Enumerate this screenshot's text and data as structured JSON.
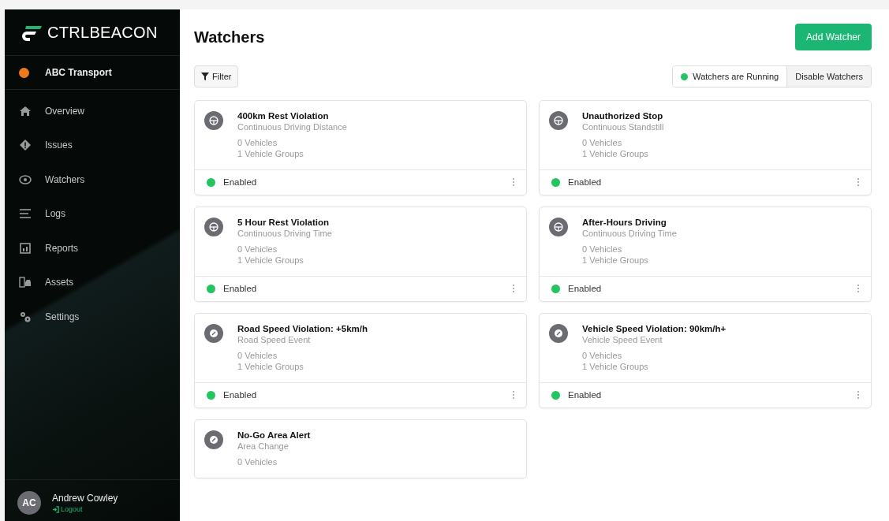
{
  "brand": {
    "logo": "**CTRL**BEACON"
  },
  "organization": {
    "name": "ABC Transport",
    "color": "#f07a1a"
  },
  "nav": [
    {
      "label": "Overview",
      "kind": "home",
      "selected": false
    },
    {
      "label": "Issues",
      "kind": "diamond",
      "selected": false
    },
    {
      "label": "Watchers",
      "kind": "eye",
      "selected": false
    },
    {
      "label": "Logs",
      "kind": "lines",
      "selected": false
    },
    {
      "label": "Reports",
      "kind": "report",
      "selected": false
    },
    {
      "label": "Assets",
      "kind": "assets",
      "selected": false
    },
    {
      "label": "Settings",
      "kind": "gears",
      "selected": false
    }
  ],
  "user": {
    "initials": "AC",
    "name": "Andrew Cowley",
    "logout": "Logout"
  },
  "page": {
    "title": "Watchers",
    "add_button": "Add Watcher",
    "filter_button": "Filter",
    "status": {
      "label": "Watchers are Running",
      "running": true
    },
    "toggle_button": "Disable Watchers"
  },
  "watchers": [
    {
      "title": "400km Rest Violation",
      "type": "Continuous Driving Distance",
      "kind": "wheel",
      "vehicles": "0 Vehicles",
      "groups": "1 Vehicle Groups",
      "status": "Enabled",
      "enabled": true
    },
    {
      "title": "Unauthorized Stop",
      "type": "Continuous Standstill",
      "kind": "wheel",
      "vehicles": "0 Vehicles",
      "groups": "1 Vehicle Groups",
      "status": "Enabled",
      "enabled": true
    },
    {
      "title": "5 Hour Rest Violation",
      "type": "Continuous Driving Time",
      "kind": "wheel",
      "vehicles": "0 Vehicles",
      "groups": "1 Vehicle Groups",
      "status": "Enabled",
      "enabled": true
    },
    {
      "title": "After-Hours Driving",
      "type": "Continuous Driving Time",
      "kind": "wheel",
      "vehicles": "0 Vehicles",
      "groups": "1 Vehicle Groups",
      "status": "Enabled",
      "enabled": true
    },
    {
      "title": "Road Speed Violation: +5km/h",
      "type": "Road Speed Event",
      "kind": "gauge",
      "vehicles": "0 Vehicles",
      "groups": "1 Vehicle Groups",
      "status": "Enabled",
      "enabled": true
    },
    {
      "title": "Vehicle Speed Violation: 90km/h+",
      "type": "Vehicle Speed Event",
      "kind": "gauge",
      "vehicles": "0 Vehicles",
      "groups": "1 Vehicle Groups",
      "status": "Enabled",
      "enabled": true
    },
    {
      "title": "No-Go Area Alert",
      "type": "Area Change",
      "kind": "gauge",
      "vehicles": "0 Vehicles"
    }
  ]
}
